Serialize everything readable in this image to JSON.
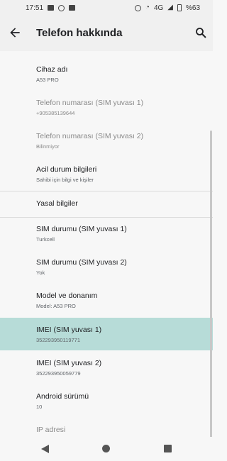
{
  "status_bar": {
    "time": "17:51",
    "network": "4G",
    "battery": "%63",
    "left_icons": [
      "image-icon",
      "whatsapp-icon",
      "message-icon"
    ],
    "right_icons": [
      "alarm-icon",
      "wifi-icon",
      "signal-icon",
      "battery-icon"
    ]
  },
  "app_bar": {
    "title": "Telefon hakkında"
  },
  "items": [
    {
      "title": "Cihaz adı",
      "subtitle": "A53 PRO"
    },
    {
      "title": "Telefon numarası (SIM yuvası 1)",
      "subtitle": "+905385139644"
    },
    {
      "title": "Telefon numarası (SIM yuvası 2)",
      "subtitle": "Bilinmiyor"
    },
    {
      "title": "Acil durum bilgileri",
      "subtitle": "Sahibi için bilgi ve kişiler"
    },
    {
      "title": "Yasal bilgiler",
      "subtitle": ""
    },
    {
      "title": "SIM durumu (SIM yuvası 1)",
      "subtitle": "Turkcell"
    },
    {
      "title": "SIM durumu (SIM yuvası 2)",
      "subtitle": "Yok"
    },
    {
      "title": "Model ve donanım",
      "subtitle": "Model: A53 PRO"
    },
    {
      "title": "IMEI (SIM yuvası 1)",
      "subtitle": "352293950119771"
    },
    {
      "title": "IMEI (SIM yuvası 2)",
      "subtitle": "352293950059779"
    },
    {
      "title": "Android sürümü",
      "subtitle": "10"
    },
    {
      "title": "IP adresi",
      "subtitle": ""
    }
  ],
  "colors": {
    "selected_row": "#b7dcd8",
    "background": "#f7f7f7"
  }
}
